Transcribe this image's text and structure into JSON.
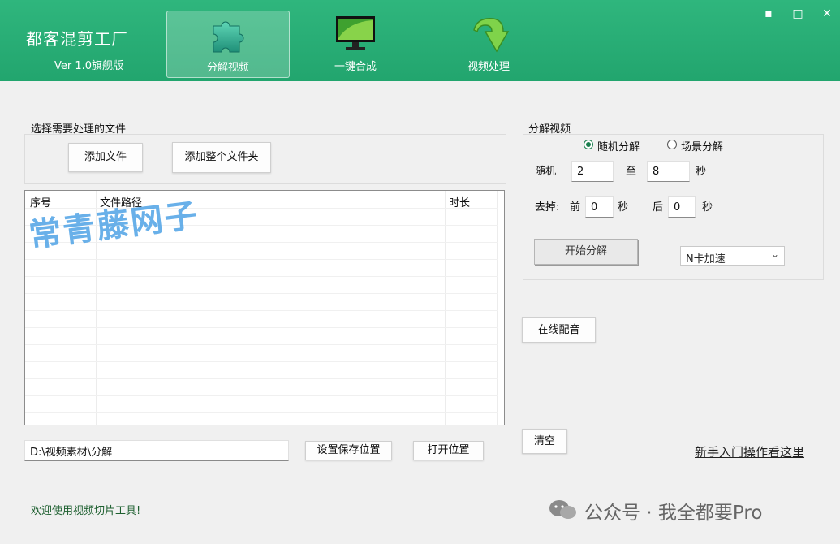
{
  "app": {
    "title": "都客混剪工厂",
    "version": "Ver 1.0旗舰版"
  },
  "tabs": [
    {
      "label": "分解视频",
      "icon": "puzzle-icon"
    },
    {
      "label": "一键合成",
      "icon": "monitor-icon"
    },
    {
      "label": "视频处理",
      "icon": "green-arrow-icon"
    }
  ],
  "window": {
    "minimize": "▪",
    "maximize": "□",
    "close": "✕"
  },
  "files": {
    "group_label": "选择需要处理的文件",
    "add_file": "添加文件",
    "add_folder": "添加整个文件夹",
    "columns": [
      "序号",
      "文件路径",
      "时长"
    ],
    "rows": []
  },
  "save": {
    "path": "D:\\视频素材\\分解",
    "set_location": "设置保存位置",
    "open_location": "打开位置"
  },
  "split": {
    "group_label": "分解视频",
    "mode_random": "随机分解",
    "mode_scene": "场景分解",
    "selected_mode": "随机分解",
    "random_label": "随机",
    "random_min": "2",
    "to_label": "至",
    "random_max": "8",
    "seconds": "秒",
    "trim_label": "去掉:",
    "front_label": "前",
    "trim_front": "0",
    "back_label": "后",
    "trim_back": "0",
    "start_button": "开始分解",
    "accel": "N卡加速"
  },
  "online_dub": "在线配音",
  "clear": "清空",
  "guide_link": "新手入门操作看这里",
  "status": "欢迎使用视频切片工具!",
  "overlays": {
    "watermark": "常青藤网子",
    "wechat": "公众号 · 我全都要Pro"
  },
  "colors": {
    "header": "#22a56e",
    "accent": "#1a7f4e"
  }
}
